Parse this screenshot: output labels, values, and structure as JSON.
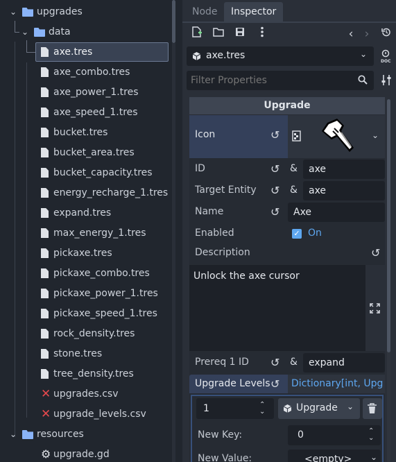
{
  "tree": {
    "items": [
      {
        "label": "upgrades",
        "type": "folder"
      },
      {
        "label": "data",
        "type": "folder"
      },
      {
        "label": "axe.tres",
        "type": "file"
      },
      {
        "label": "axe_combo.tres",
        "type": "file"
      },
      {
        "label": "axe_power_1.tres",
        "type": "file"
      },
      {
        "label": "axe_speed_1.tres",
        "type": "file"
      },
      {
        "label": "bucket.tres",
        "type": "file"
      },
      {
        "label": "bucket_area.tres",
        "type": "file"
      },
      {
        "label": "bucket_capacity.tres",
        "type": "file"
      },
      {
        "label": "energy_recharge_1.tres",
        "type": "file"
      },
      {
        "label": "expand.tres",
        "type": "file"
      },
      {
        "label": "max_energy_1.tres",
        "type": "file"
      },
      {
        "label": "pickaxe.tres",
        "type": "file"
      },
      {
        "label": "pickaxe_combo.tres",
        "type": "file"
      },
      {
        "label": "pickaxe_power_1.tres",
        "type": "file"
      },
      {
        "label": "pickaxe_speed_1.tres",
        "type": "file"
      },
      {
        "label": "rock_density.tres",
        "type": "file"
      },
      {
        "label": "stone.tres",
        "type": "file"
      },
      {
        "label": "tree_density.tres",
        "type": "file"
      },
      {
        "label": "upgrades.csv",
        "type": "error"
      },
      {
        "label": "upgrade_levels.csv",
        "type": "error"
      },
      {
        "label": "resources",
        "type": "folder"
      },
      {
        "label": "upgrade.gd",
        "type": "script"
      }
    ],
    "selected": "axe.tres"
  },
  "tabs": {
    "node": "Node",
    "inspector": "Inspector"
  },
  "toolbar": {
    "new_icon": "new-resource-icon",
    "open_icon": "open-folder-icon",
    "save_icon": "save-icon",
    "more_icon": "more-icon",
    "back_icon": "back-icon",
    "forward_icon": "forward-icon",
    "history_icon": "history-icon"
  },
  "resource": {
    "name": "axe.tres"
  },
  "filter": {
    "placeholder": "Filter Properties"
  },
  "section": {
    "title": "Upgrade"
  },
  "props": {
    "icon_label": "Icon",
    "id_label": "ID",
    "id_value": "axe",
    "target_label": "Target Entity",
    "target_value": "axe",
    "name_label": "Name",
    "name_value": "Axe",
    "enabled_label": "Enabled",
    "enabled_value": "On",
    "description_label": "Description",
    "description_value": "Unlock the axe cursor",
    "prereq_label": "Prereq 1 ID",
    "prereq_value": "expand",
    "levels_label": "Upgrade Levels",
    "levels_value": "Dictionary[int, Upg"
  },
  "dict": {
    "key_value": "1",
    "type_label": "Upgrade",
    "new_key_label": "New Key:",
    "new_key_value": "0",
    "new_value_label": "New Value:",
    "new_value_value": "<empty>"
  },
  "colors": {
    "accent": "#5ea7f0",
    "selection": "#394253",
    "error": "#e5484d"
  }
}
